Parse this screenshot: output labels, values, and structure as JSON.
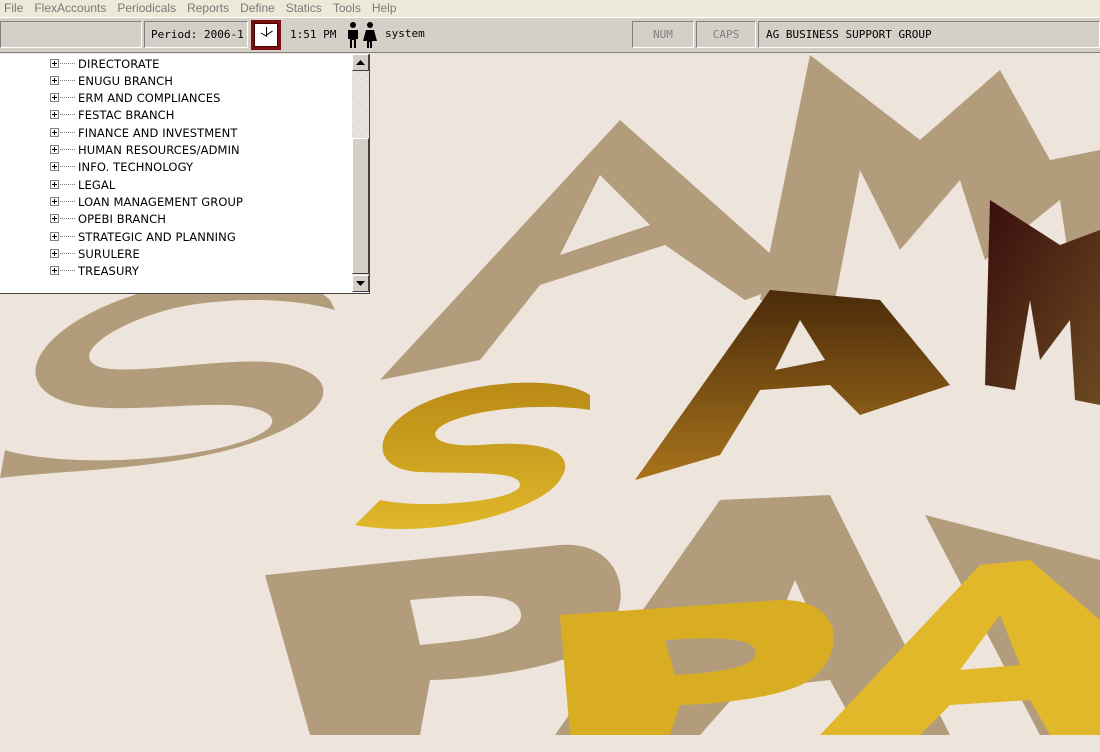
{
  "menu": [
    "File",
    "FlexAccounts",
    "Periodicals",
    "Reports",
    "Define",
    "Statics",
    "Tools",
    "Help"
  ],
  "status": {
    "period": "Period: 2006-1",
    "time": "1:51 PM",
    "user": "system",
    "num": "NUM",
    "caps": "CAPS",
    "company": "AG BUSINESS SUPPORT GROUP"
  },
  "tree": {
    "items": [
      "DIRECTORATE",
      "ENUGU BRANCH",
      "ERM AND COMPLIANCES",
      "FESTAC BRANCH",
      "FINANCE AND INVESTMENT",
      "HUMAN RESOURCES/ADMIN",
      "INFO. TECHNOLOGY",
      "LEGAL",
      "LOAN MANAGEMENT GROUP",
      "OPEBI BRANCH",
      "STRATEGIC AND PLANNING",
      "SURULERE",
      "TREASURY"
    ]
  },
  "colors": {
    "desktop": "#ede4dc",
    "tan_logo": "#b39c7c",
    "gold_logo": "#d9ad22",
    "brown_logo": "#6a3d14"
  },
  "icons": {
    "clock": "clock-icon",
    "users": "users-icon",
    "expand": "tree-expand-icon"
  }
}
